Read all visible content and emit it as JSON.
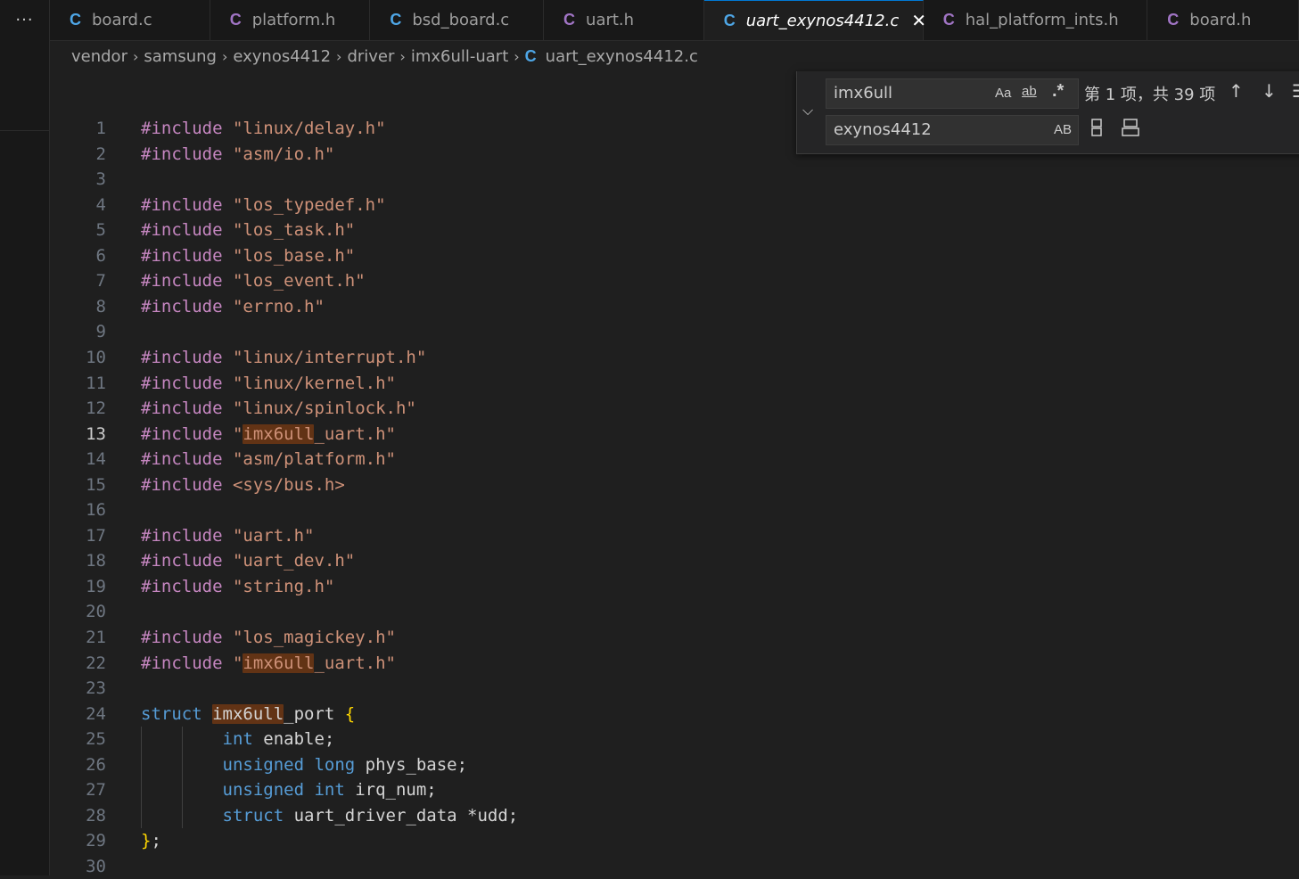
{
  "activity": {
    "more_icon": "···"
  },
  "tabs": [
    {
      "name": "board.c",
      "icon": "C",
      "icon_color": "#4ea6e6"
    },
    {
      "name": "platform.h",
      "icon": "C",
      "icon_color": "#a074c4"
    },
    {
      "name": "bsd_board.c",
      "icon": "C",
      "icon_color": "#4ea6e6"
    },
    {
      "name": "uart.h",
      "icon": "C",
      "icon_color": "#a074c4"
    },
    {
      "name": "uart_exynos4412.c",
      "icon": "C",
      "icon_color": "#4ea6e6",
      "close": "✕"
    },
    {
      "name": "hal_platform_ints.h",
      "icon": "C",
      "icon_color": "#a074c4"
    },
    {
      "name": "board.h",
      "icon": "C",
      "icon_color": "#a074c4"
    }
  ],
  "breadcrumb": {
    "items": [
      "vendor",
      "samsung",
      "exynos4412",
      "driver",
      "imx6ull-uart"
    ],
    "file_icon": "C",
    "file": "uart_exynos4412.c"
  },
  "find": {
    "toggle_icon": "chevron-down-icon",
    "search_value": "imx6ull",
    "replace_value": "exynos4412",
    "match_case": "Aa",
    "whole_word": "ab",
    "regex": ".*",
    "preserve_case": "AB",
    "match_count": "第 1 项，共 39 项",
    "prev_icon": "↑",
    "next_icon": "↓",
    "selection_icon": "☰"
  },
  "editor": {
    "current_line": 13,
    "lines": [
      {
        "n": "1",
        "parts": [
          [
            "inc",
            "#include "
          ],
          [
            "str",
            "\"linux/delay.h\""
          ]
        ]
      },
      {
        "n": "2",
        "parts": [
          [
            "inc",
            "#include "
          ],
          [
            "str",
            "\"asm/io.h\""
          ]
        ]
      },
      {
        "n": "3",
        "parts": []
      },
      {
        "n": "4",
        "parts": [
          [
            "inc",
            "#include "
          ],
          [
            "str",
            "\"los_typedef.h\""
          ]
        ]
      },
      {
        "n": "5",
        "parts": [
          [
            "inc",
            "#include "
          ],
          [
            "str",
            "\"los_task.h\""
          ]
        ]
      },
      {
        "n": "6",
        "parts": [
          [
            "inc",
            "#include "
          ],
          [
            "str",
            "\"los_base.h\""
          ]
        ]
      },
      {
        "n": "7",
        "parts": [
          [
            "inc",
            "#include "
          ],
          [
            "str",
            "\"los_event.h\""
          ]
        ]
      },
      {
        "n": "8",
        "parts": [
          [
            "inc",
            "#include "
          ],
          [
            "str",
            "\"errno.h\""
          ]
        ]
      },
      {
        "n": "9",
        "parts": []
      },
      {
        "n": "10",
        "parts": [
          [
            "inc",
            "#include "
          ],
          [
            "str",
            "\"linux/interrupt.h\""
          ]
        ]
      },
      {
        "n": "11",
        "parts": [
          [
            "inc",
            "#include "
          ],
          [
            "str",
            "\"linux/kernel.h\""
          ]
        ]
      },
      {
        "n": "12",
        "parts": [
          [
            "inc",
            "#include "
          ],
          [
            "str",
            "\"linux/spinlock.h\""
          ]
        ]
      },
      {
        "n": "13",
        "parts": [
          [
            "inc",
            "#include "
          ],
          [
            "str",
            "\""
          ],
          [
            "strhl",
            "imx6ull"
          ],
          [
            "str",
            "_uart.h\""
          ]
        ]
      },
      {
        "n": "14",
        "parts": [
          [
            "inc",
            "#include "
          ],
          [
            "str",
            "\"asm/platform.h\""
          ]
        ]
      },
      {
        "n": "15",
        "parts": [
          [
            "inc",
            "#include "
          ],
          [
            "str",
            "<sys/bus.h>"
          ]
        ]
      },
      {
        "n": "16",
        "parts": []
      },
      {
        "n": "17",
        "parts": [
          [
            "inc",
            "#include "
          ],
          [
            "str",
            "\"uart.h\""
          ]
        ]
      },
      {
        "n": "18",
        "parts": [
          [
            "inc",
            "#include "
          ],
          [
            "str",
            "\"uart_dev.h\""
          ]
        ]
      },
      {
        "n": "19",
        "parts": [
          [
            "inc",
            "#include "
          ],
          [
            "str",
            "\"string.h\""
          ]
        ]
      },
      {
        "n": "20",
        "parts": []
      },
      {
        "n": "21",
        "parts": [
          [
            "inc",
            "#include "
          ],
          [
            "str",
            "\"los_magickey.h\""
          ]
        ]
      },
      {
        "n": "22",
        "parts": [
          [
            "inc",
            "#include "
          ],
          [
            "str",
            "\""
          ],
          [
            "strhl",
            "imx6ull"
          ],
          [
            "str",
            "_uart.h\""
          ]
        ]
      },
      {
        "n": "23",
        "parts": []
      },
      {
        "n": "24",
        "parts": [
          [
            "kw",
            "struct "
          ],
          [
            "idhl",
            "imx6ull"
          ],
          [
            "id",
            "_port "
          ],
          [
            "brace",
            "{"
          ]
        ]
      },
      {
        "n": "25",
        "parts": [
          [
            "pad",
            "        "
          ],
          [
            "kw",
            "int "
          ],
          [
            "id",
            "enable;"
          ]
        ]
      },
      {
        "n": "26",
        "parts": [
          [
            "pad",
            "        "
          ],
          [
            "kw",
            "unsigned long "
          ],
          [
            "id",
            "phys_base;"
          ]
        ]
      },
      {
        "n": "27",
        "parts": [
          [
            "pad",
            "        "
          ],
          [
            "kw",
            "unsigned int "
          ],
          [
            "id",
            "irq_num;"
          ]
        ]
      },
      {
        "n": "28",
        "parts": [
          [
            "pad",
            "        "
          ],
          [
            "kw",
            "struct "
          ],
          [
            "id",
            "uart_driver_data *udd;"
          ]
        ]
      },
      {
        "n": "29",
        "parts": [
          [
            "brace",
            "}"
          ],
          [
            "id",
            ";"
          ]
        ]
      },
      {
        "n": "30",
        "parts": []
      }
    ]
  }
}
